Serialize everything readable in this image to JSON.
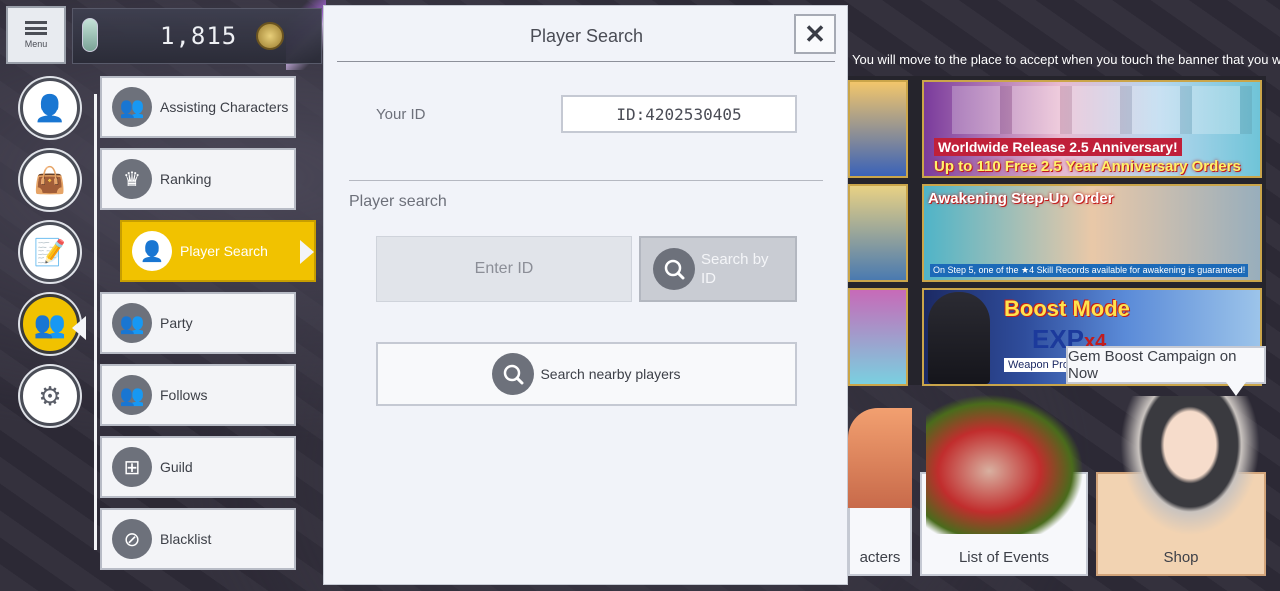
{
  "topbar": {
    "menu_label": "Menu",
    "gem_count": "1,815"
  },
  "left_nav": [
    {
      "icon": "person-icon",
      "glyph": "👤",
      "active": false
    },
    {
      "icon": "shop-bag-icon",
      "glyph": "👜",
      "active": false
    },
    {
      "icon": "notes-icon",
      "glyph": "📝",
      "active": false
    },
    {
      "icon": "friends-icon",
      "glyph": "👥",
      "active": true
    },
    {
      "icon": "gear-icon",
      "glyph": "⚙",
      "active": false
    }
  ],
  "submenu": {
    "items": [
      {
        "label": "Assisting Characters",
        "icon": "assist-icon",
        "glyph": "👥"
      },
      {
        "label": "Ranking",
        "icon": "crown-icon",
        "glyph": "♛"
      },
      {
        "label": "Player Search",
        "icon": "player-search-icon",
        "glyph": "👤"
      },
      {
        "label": "Party",
        "icon": "party-icon",
        "glyph": "👥"
      },
      {
        "label": "Follows",
        "icon": "follows-icon",
        "glyph": "👥"
      },
      {
        "label": "Guild",
        "icon": "guild-icon",
        "glyph": "⊞"
      },
      {
        "label": "Blacklist",
        "icon": "blacklist-icon",
        "glyph": "⊘"
      }
    ]
  },
  "dialog": {
    "title": "Player Search",
    "close_glyph": "✕",
    "your_id_label": "Your ID",
    "your_id_value": "ID:4202530405",
    "player_search_label": "Player search",
    "enter_id_placeholder": "Enter ID",
    "search_by_id_label": "Search by ID",
    "search_nearby_label": "Search nearby players"
  },
  "right": {
    "info_text": "You will move to the place to accept when you touch the banner that you want to play.",
    "banner1_line1": "Worldwide Release 2.5 Anniversary!",
    "banner1_line2": "Up to 110 Free 2.5 Year Anniversary Orders",
    "banner2_title": "Awakening Step-Up Order",
    "banner2_sub": "On Step 5, one of the ★4 Skill Records available for awakening is guaranteed!",
    "banner3_title": "Boost Mode",
    "banner3_exp": "EXP",
    "banner3_mult": "x4",
    "banner3_sub": "Weapon Pro",
    "tooltip": "Gem Boost Campaign on Now",
    "tile_chars": "acters",
    "tile_events": "List of Events",
    "tile_shop": "Shop"
  }
}
